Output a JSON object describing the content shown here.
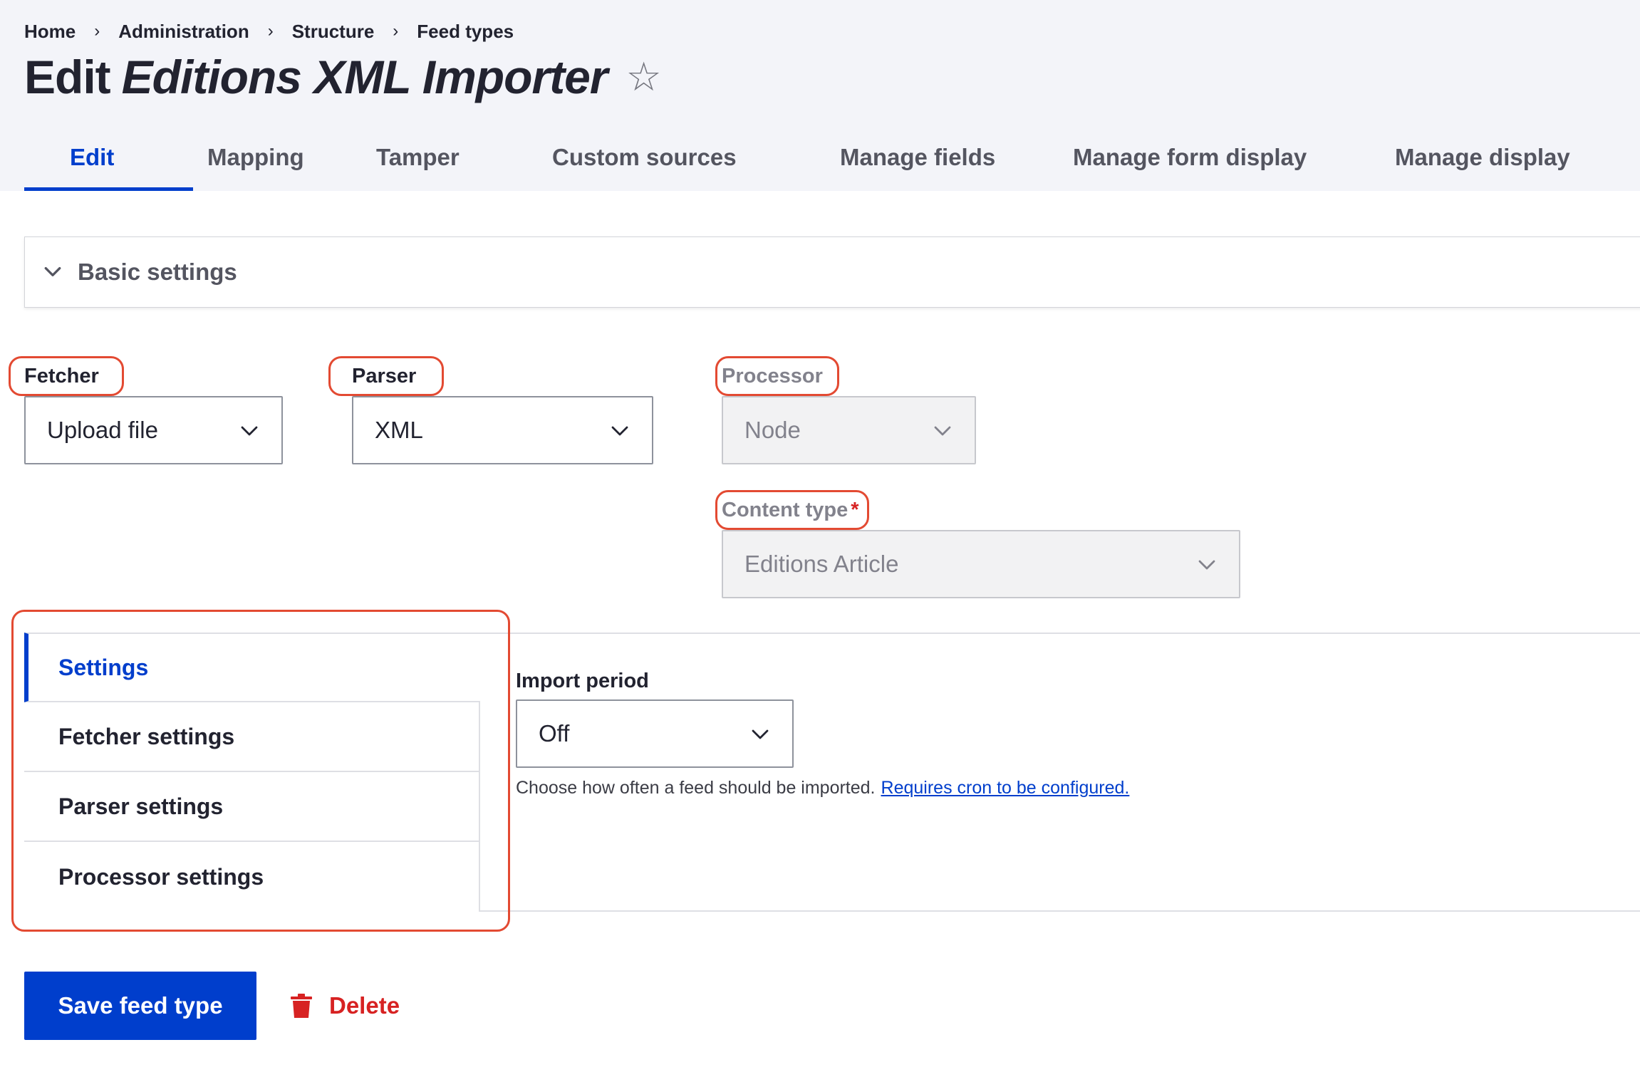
{
  "breadcrumb": [
    {
      "label": "Home"
    },
    {
      "label": "Administration"
    },
    {
      "label": "Structure"
    },
    {
      "label": "Feed types"
    }
  ],
  "breadcrumb_separator": "›",
  "page_title": {
    "prefix": "Edit",
    "emphasis": "Editions XML Importer",
    "favorite_icon": "star-outline-icon",
    "favorite_glyph": "☆"
  },
  "tabs": [
    {
      "label": "Edit",
      "active": true
    },
    {
      "label": "Mapping",
      "active": false
    },
    {
      "label": "Tamper",
      "active": false
    },
    {
      "label": "Custom sources",
      "active": false
    },
    {
      "label": "Manage fields",
      "active": false
    },
    {
      "label": "Manage form display",
      "active": false
    },
    {
      "label": "Manage display",
      "active": false
    }
  ],
  "basic_settings": {
    "label": "Basic settings",
    "expanded": true,
    "icon": "chevron-down-icon"
  },
  "form": {
    "fetcher": {
      "label": "Fetcher",
      "value": "Upload file",
      "disabled": false,
      "highlighted": true
    },
    "parser": {
      "label": "Parser",
      "value": "XML",
      "disabled": false,
      "highlighted": true
    },
    "processor": {
      "label": "Processor",
      "value": "Node",
      "disabled": true,
      "highlighted": true
    },
    "content_type": {
      "label": "Content type",
      "required_marker": "*",
      "value": "Editions Article",
      "disabled": true,
      "highlighted": true
    }
  },
  "vertical_tabs": {
    "items": [
      {
        "label": "Settings",
        "active": true
      },
      {
        "label": "Fetcher settings",
        "active": false
      },
      {
        "label": "Parser settings",
        "active": false
      },
      {
        "label": "Processor settings",
        "active": false
      }
    ],
    "highlighted": true
  },
  "import_period": {
    "label": "Import period",
    "value": "Off",
    "description": "Choose how often a feed should be imported.",
    "link_text": "Requires cron to be configured."
  },
  "actions": {
    "save_label": "Save feed type",
    "delete_label": "Delete",
    "delete_icon": "trash-icon"
  },
  "colors": {
    "accent": "#003ecc",
    "danger": "#d72222",
    "highlight": "#e34a32",
    "header_bg": "#f3f4f9"
  }
}
